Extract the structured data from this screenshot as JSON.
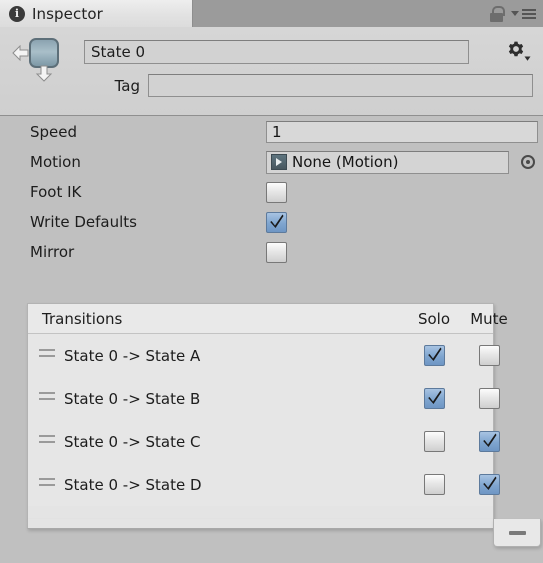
{
  "window": {
    "tab_label": "Inspector",
    "info_icon": "info-icon",
    "lock_icon": "lock-icon",
    "menu_icon": "hamburger-menu-icon"
  },
  "header": {
    "state_icon": "animator-state-icon",
    "name_value": "State 0",
    "gear_icon": "gear-icon",
    "tag_label": "Tag",
    "tag_value": ""
  },
  "properties": [
    {
      "label": "Speed",
      "type": "number",
      "value": "1"
    },
    {
      "label": "Motion",
      "type": "object",
      "value": "None (Motion)",
      "icon": "motion-clip-icon",
      "picker": "object-picker-icon"
    },
    {
      "label": "Foot IK",
      "type": "checkbox",
      "checked": false
    },
    {
      "label": "Write Defaults",
      "type": "checkbox",
      "checked": true
    },
    {
      "label": "Mirror",
      "type": "checkbox",
      "checked": false
    }
  ],
  "transitions": {
    "title": "Transitions",
    "col_solo": "Solo",
    "col_mute": "Mute",
    "rows": [
      {
        "label": "State 0 -> State A",
        "solo": true,
        "mute": false
      },
      {
        "label": "State 0 -> State B",
        "solo": true,
        "mute": false
      },
      {
        "label": "State 0 -> State C",
        "solo": false,
        "mute": true
      },
      {
        "label": "State 0 -> State D",
        "solo": false,
        "mute": true
      }
    ],
    "remove_button_icon": "minus-icon"
  },
  "colors": {
    "window_bg": "#c0c0c0",
    "toolbar_bg": "#9b9b9b",
    "header_bg": "#d2d2d2",
    "list_bg": "#e6e6e6",
    "checkbox_on": "#7fa5cf"
  }
}
